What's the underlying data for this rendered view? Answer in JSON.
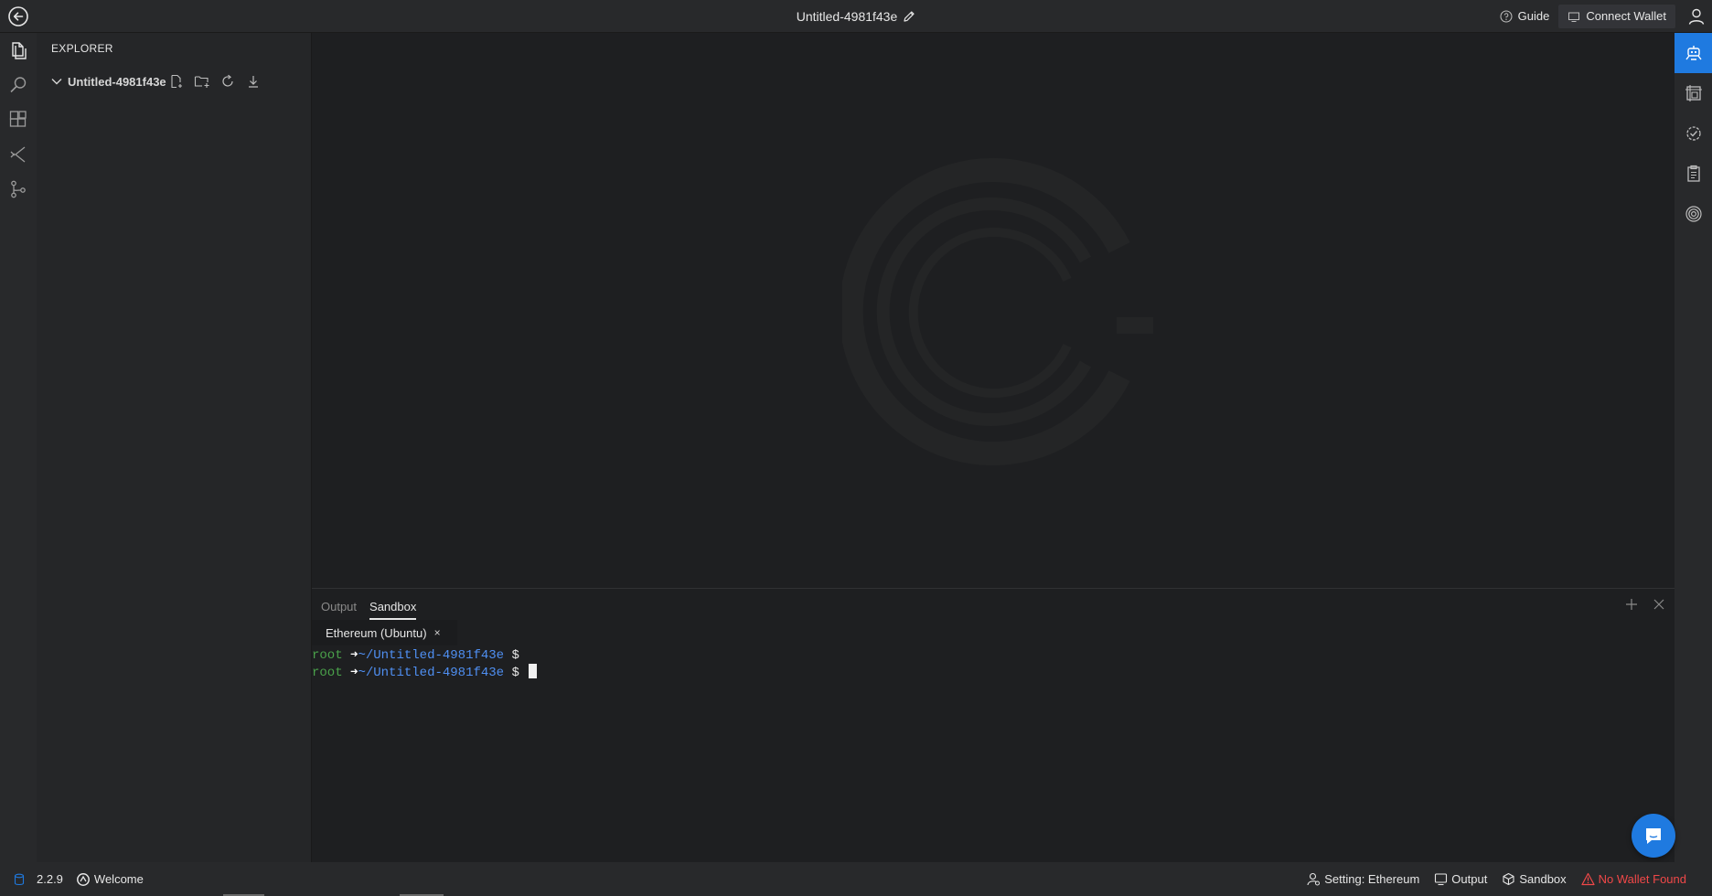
{
  "titlebar": {
    "project_title": "Untitled-4981f43e",
    "guide_label": "Guide",
    "connect_wallet_label": "Connect Wallet"
  },
  "explorer": {
    "header": "EXPLORER",
    "root_folder": "Untitled-4981f43e"
  },
  "panel": {
    "tabs": [
      {
        "label": "Output"
      },
      {
        "label": "Sandbox"
      }
    ],
    "active_tab": "Sandbox",
    "terminal_tab_label": "Ethereum (Ubuntu)",
    "terminal_tab_close": "×",
    "lines": [
      {
        "user": "root",
        "arrow": "➜",
        "path": "~/Untitled-4981f43e",
        "prompt": "$"
      },
      {
        "user": "root",
        "arrow": "➜",
        "path": "~/Untitled-4981f43e",
        "prompt": "$"
      }
    ]
  },
  "statusbar": {
    "version": "2.2.9",
    "welcome": "Welcome",
    "setting": "Setting: Ethereum",
    "output": "Output",
    "sandbox": "Sandbox",
    "wallet_status": "No Wallet Found"
  },
  "colors": {
    "accent": "#1f7ae0",
    "error": "#f04848",
    "terminal_user": "#4aa14a",
    "terminal_path": "#4f8ff2"
  },
  "icons": {
    "activity": [
      "files-icon",
      "search-icon",
      "extensions-icon",
      "compare-icon",
      "git-branch-icon"
    ],
    "rightbar": [
      "robot-icon",
      "frame-icon",
      "gear-check-icon",
      "clipboard-icon",
      "fingerprint-icon"
    ]
  }
}
